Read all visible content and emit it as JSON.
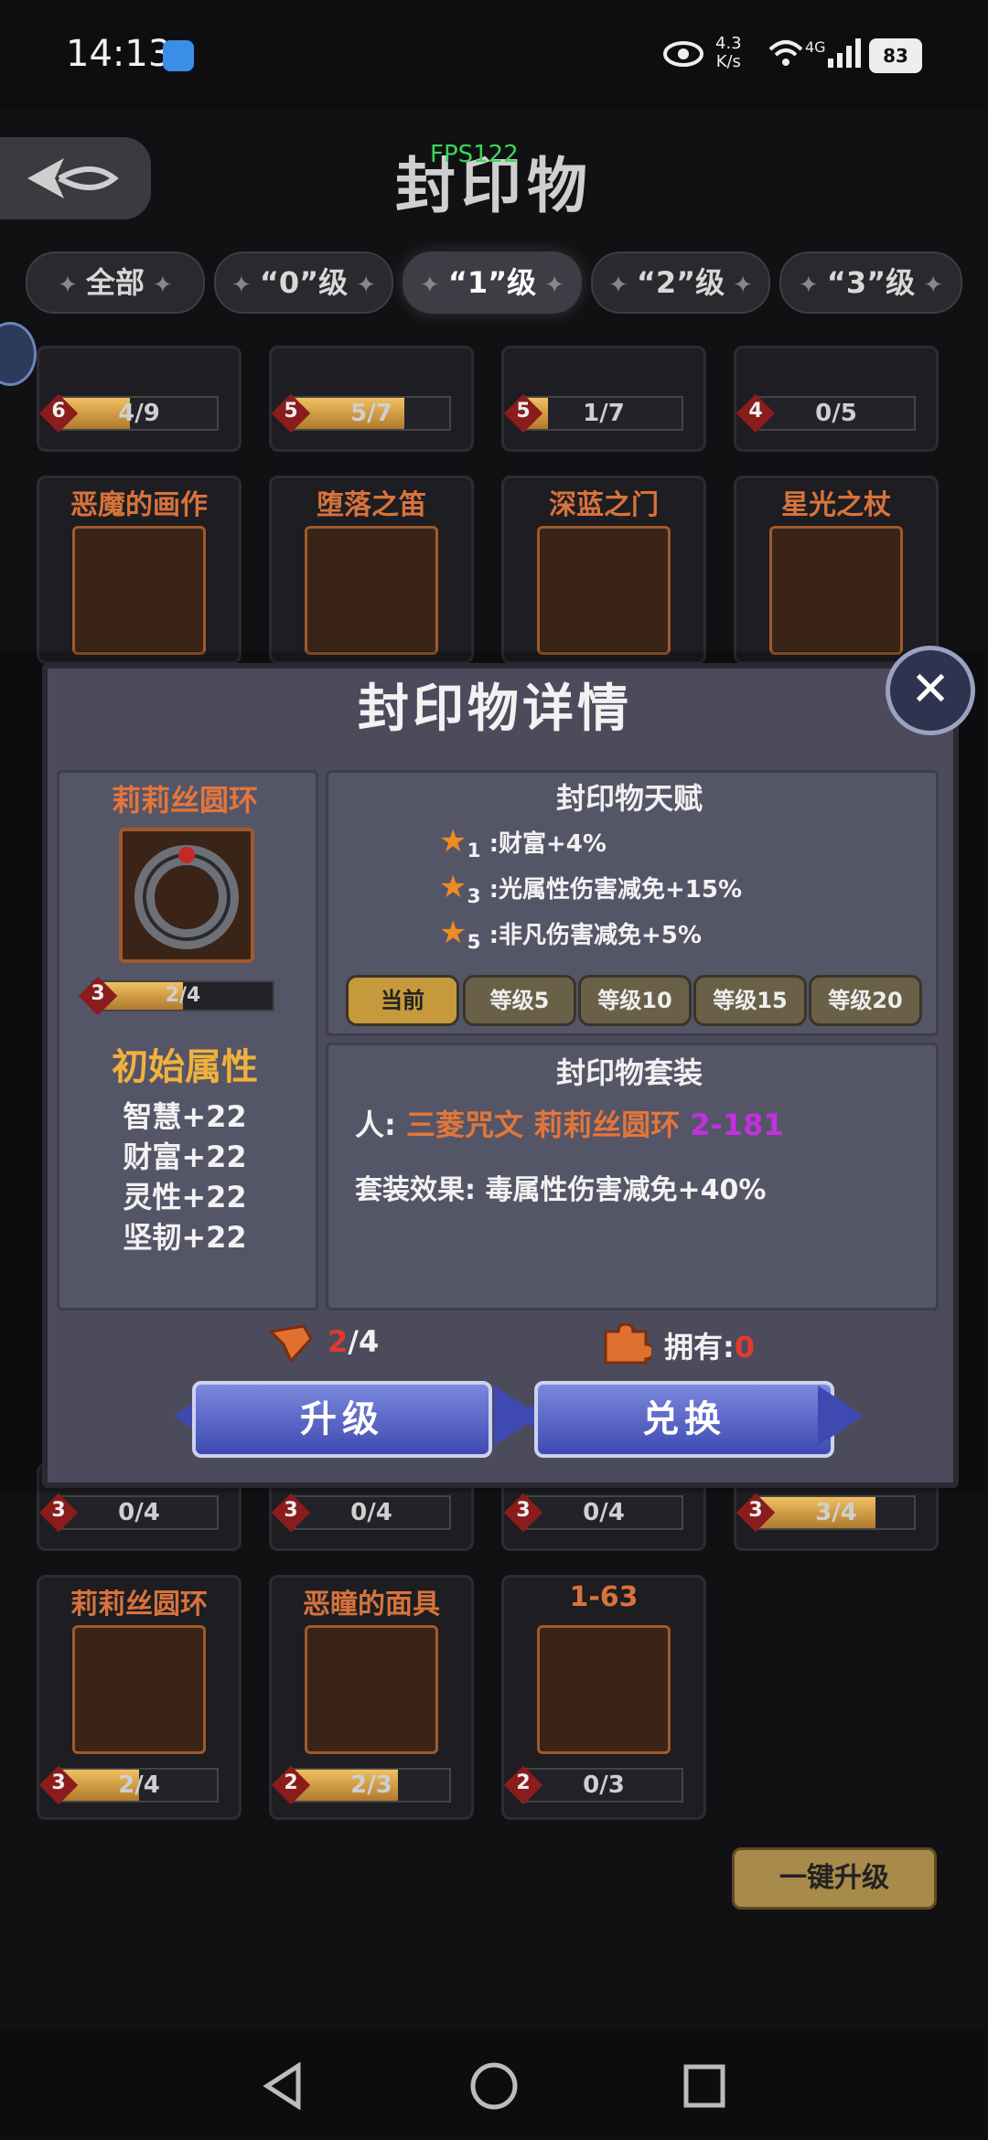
{
  "status_bar": {
    "time": "14:13",
    "speed_value": "4.3",
    "speed_unit": "K/s",
    "network": "4G",
    "battery": "83"
  },
  "header": {
    "title": "封印物",
    "fps": "FPS122"
  },
  "tabs": [
    {
      "label": "全部",
      "active": false
    },
    {
      "label": "“0”级",
      "active": false
    },
    {
      "label": "“1”级",
      "active": true
    },
    {
      "label": "“2”级",
      "active": false
    },
    {
      "label": "“3”级",
      "active": false
    }
  ],
  "top_row": [
    {
      "level": "6",
      "progress": "4/9",
      "fill": 0.44
    },
    {
      "level": "5",
      "progress": "5/7",
      "fill": 0.71
    },
    {
      "level": "5",
      "progress": "1/7",
      "fill": 0.14
    },
    {
      "level": "4",
      "progress": "0/5",
      "fill": 0.0
    }
  ],
  "row2": [
    {
      "name": "恶魔的画作"
    },
    {
      "name": "堕落之笛"
    },
    {
      "name": "深蓝之门"
    },
    {
      "name": "星光之杖"
    }
  ],
  "row3_bars": [
    {
      "level": "3",
      "progress": "0/4",
      "fill": 0.0
    },
    {
      "level": "3",
      "progress": "0/4",
      "fill": 0.0
    },
    {
      "level": "3",
      "progress": "0/4",
      "fill": 0.0
    },
    {
      "level": "3",
      "progress": "3/4",
      "fill": 0.75
    }
  ],
  "row4": [
    {
      "name": "莉莉丝圆环",
      "level": "3",
      "progress": "2/4",
      "fill": 0.5
    },
    {
      "name": "恶瞳的面具",
      "level": "2",
      "progress": "2/3",
      "fill": 0.67
    },
    {
      "name": "1-63",
      "level": "2",
      "progress": "0/3",
      "fill": 0.0
    }
  ],
  "one_key_upgrade": "一键升级",
  "modal": {
    "title": "封印物详情",
    "item_name": "莉莉丝圆环",
    "item_level": "3",
    "item_progress": "2/4",
    "item_fill": 0.5,
    "initial_attr_title": "初始属性",
    "attributes": [
      "智慧+22",
      "财富+22",
      "灵性+22",
      "坚韧+22"
    ],
    "talent_title": "封印物天赋",
    "talents": [
      {
        "star": "1",
        "text": ":财富+4%"
      },
      {
        "star": "3",
        "text": ":光属性伤害减免+15%"
      },
      {
        "star": "5",
        "text": ":非凡伤害减免+5%"
      }
    ],
    "level_tabs": [
      "当前",
      "等级5",
      "等级10",
      "等级15",
      "等级20"
    ],
    "set_title": "封印物套装",
    "set_line": {
      "prefix": "人: ",
      "items": "三菱咒文 莉莉丝圆环 ",
      "code": "2-181"
    },
    "set_effect": "套装效果:  毒属性伤害减免+40%",
    "upgrade_cost": {
      "have": "2",
      "need": "/4"
    },
    "owned": {
      "label": "拥有:",
      "value": "0"
    },
    "upgrade_button": "升级",
    "exchange_button": "兑换"
  },
  "colors": {
    "accent_orange": "#e2763a",
    "gold": "#f0b23c",
    "purple": "#c42fe0",
    "red": "#e03a2e",
    "button_blue": "#4b58c0"
  }
}
